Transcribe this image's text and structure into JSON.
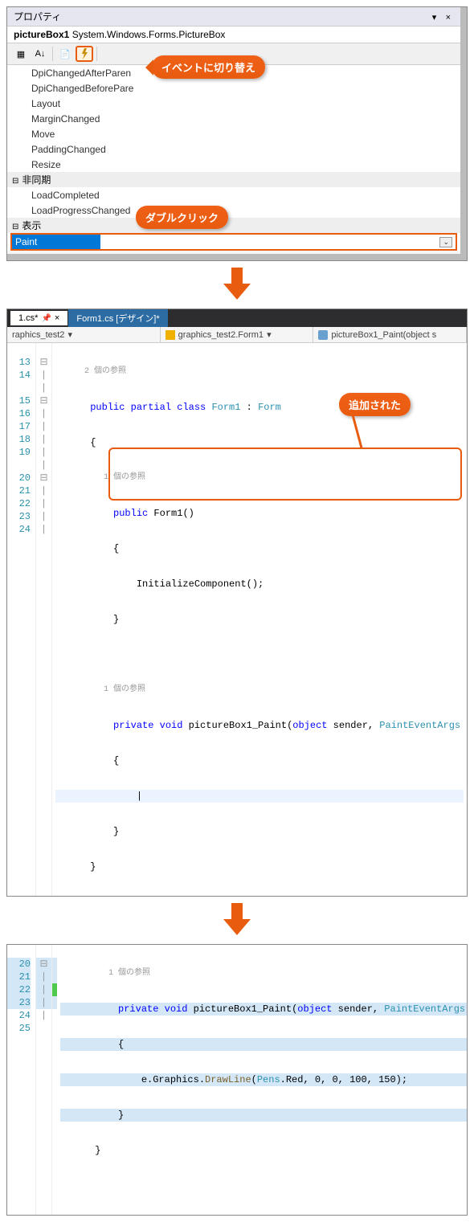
{
  "properties": {
    "title": "プロパティ",
    "object_name": "pictureBox1",
    "object_type": "System.Windows.Forms.PictureBox",
    "events": [
      "DpiChangedAfterParen",
      "DpiChangedBeforePare",
      "Layout",
      "MarginChanged",
      "Move",
      "PaddingChanged",
      "Resize"
    ],
    "cat1": "非同期",
    "cat1_items": [
      "LoadCompleted",
      "LoadProgressChanged"
    ],
    "cat2": "表示",
    "selected": "Paint"
  },
  "callouts": {
    "events_switch": "イベントに切り替え",
    "double_click": "ダブルクリック",
    "added": "追加された"
  },
  "editor": {
    "tab1": "1.cs*",
    "tab2": "Form1.cs [デザイン]*",
    "nav1": "raphics_test2",
    "nav2": "graphics_test2.Form1",
    "nav3": "pictureBox1_Paint(object s",
    "ref2": "2 個の参照",
    "ref1": "1 個の参照",
    "ln": {
      "l13": "13",
      "l14": "14",
      "l15": "15",
      "l16": "16",
      "l17": "17",
      "l18": "18",
      "l19": "19",
      "l20": "20",
      "l21": "21",
      "l22": "22",
      "l23": "23",
      "l24": "24",
      "l25": "25"
    }
  },
  "code1": {
    "l13": "public partial class Form1 : Form",
    "l14": "{",
    "l15": "public Form1()",
    "l16": "{",
    "l17": "InitializeComponent();",
    "l18": "}",
    "l20_a": "private void",
    "l20_b": "pictureBox1_Paint",
    "l20_c": "(object sender, PaintEventArgs e",
    "l21": "{",
    "l23": "}",
    "l24": "}"
  },
  "code2": {
    "l20_a": "private void",
    "l20_b": "pictureBox1_Paint",
    "l20_c": "(object sender, PaintEventArgs e",
    "l21": "{",
    "l22_a": "e.Graphics.",
    "l22_b": "DrawLine",
    "l22_c": "(Pens.Red, 0, 0, 100, 150);",
    "l23": "}",
    "l24": "}"
  }
}
